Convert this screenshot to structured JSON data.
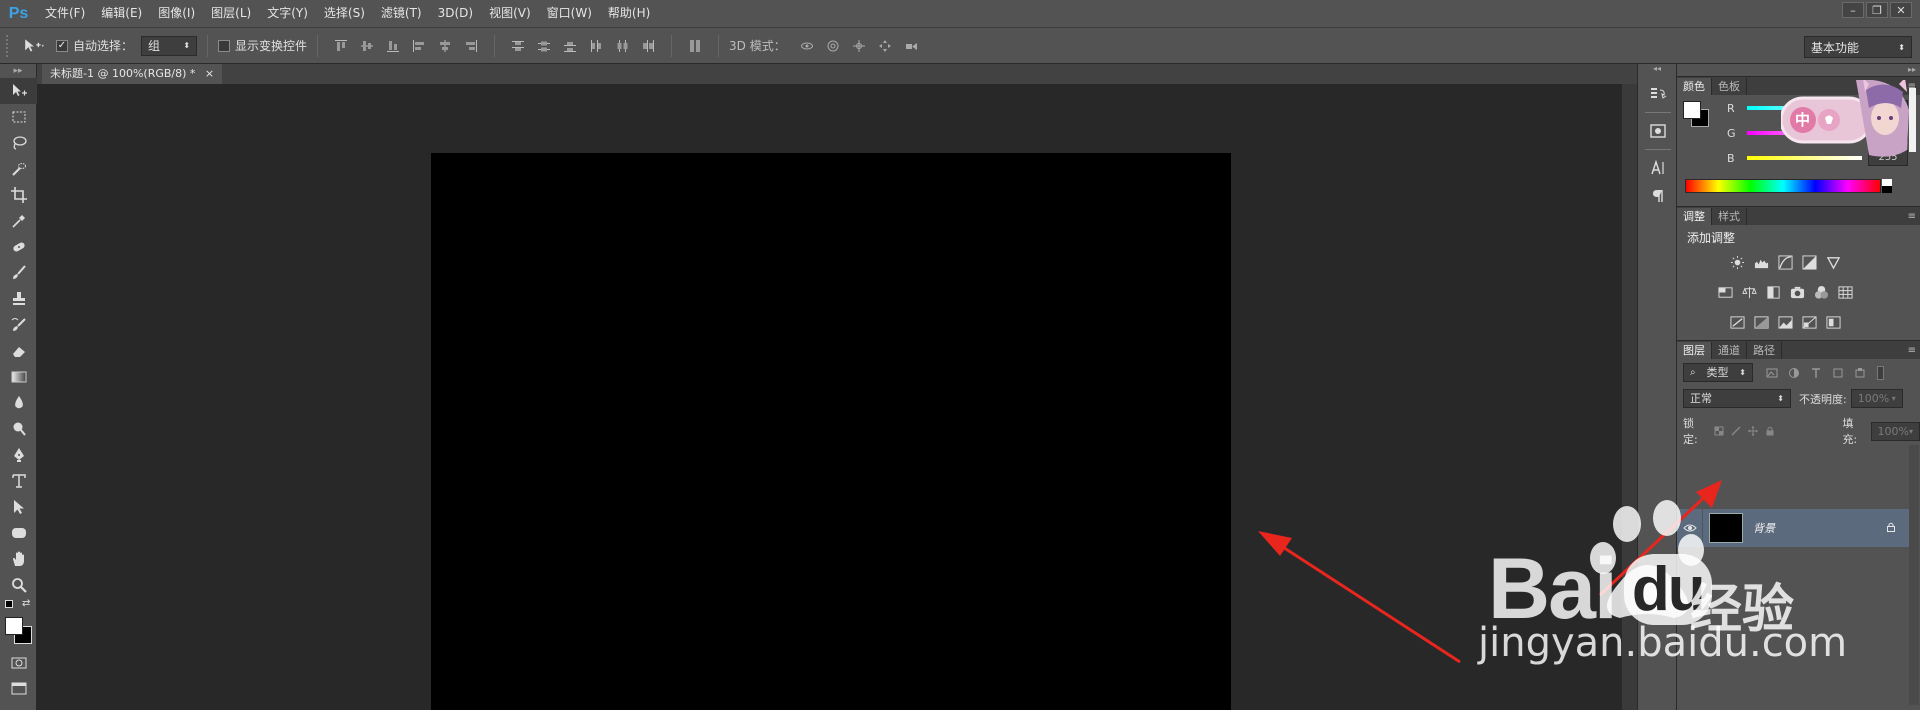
{
  "app": {
    "logo": "Ps"
  },
  "menubar": {
    "items": [
      "文件(F)",
      "编辑(E)",
      "图像(I)",
      "图层(L)",
      "文字(Y)",
      "选择(S)",
      "滤镜(T)",
      "3D(D)",
      "视图(V)",
      "窗口(W)",
      "帮助(H)"
    ],
    "window_controls": [
      "–",
      "❐",
      "✕"
    ]
  },
  "options_bar": {
    "auto_select_label": "自动选择：",
    "auto_select_checked": true,
    "auto_select_value": "组",
    "transform_controls_label": "显示变换控件",
    "mode_3d_label": "3D 模式：",
    "workspace": "基本功能"
  },
  "document": {
    "tab_title": "未标题-1 @ 100%(RGB/8) *",
    "canvas_color": "#000000"
  },
  "panels": {
    "color": {
      "tabs": [
        "颜色",
        "色板"
      ],
      "channels": [
        {
          "label": "R",
          "value": "255"
        },
        {
          "label": "G",
          "value": "255"
        },
        {
          "label": "B",
          "value": "255"
        }
      ],
      "foreground": "#ffffff",
      "background": "#000000"
    },
    "adjustments": {
      "tabs": [
        "调整",
        "样式"
      ],
      "heading": "添加调整"
    },
    "layers": {
      "tabs": [
        "图层",
        "通道",
        "路径"
      ],
      "filter_kind": "类型",
      "blend_mode": "正常",
      "opacity_label": "不透明度:",
      "opacity_value": "100%",
      "lock_label": "锁定:",
      "fill_label": "填充:",
      "fill_value": "100%",
      "layer_name": "背景"
    }
  },
  "sticker": {
    "text": "中"
  },
  "watermark": {
    "brand": "Bai",
    "brand_du": "du",
    "brand_cn": "经验",
    "url": "jingyan.baidu.com"
  },
  "colors": {
    "chrome": "#535353",
    "workspace": "#282828",
    "selected_layer": "#5c6a7e",
    "annotation_arrow": "#e8261e"
  }
}
